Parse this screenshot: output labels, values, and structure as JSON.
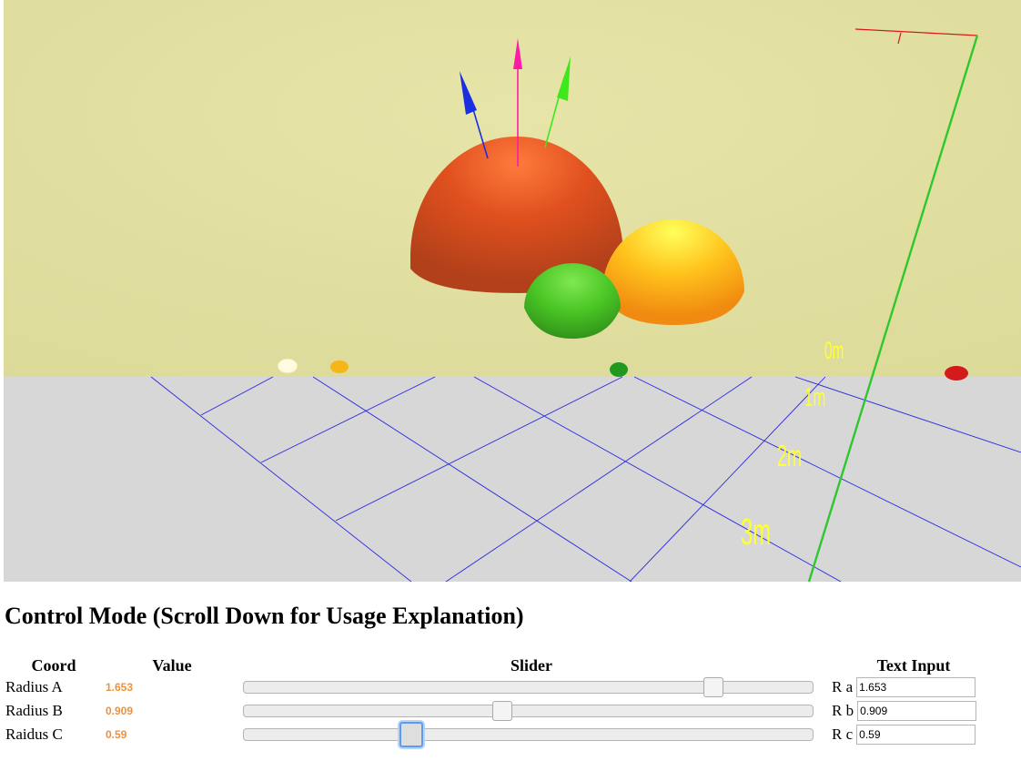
{
  "scene": {
    "colors": {
      "sky": "#e1df9e",
      "floor": "#d7d7d7",
      "grid": "#2a2ae0",
      "axis_x": "#d81818",
      "axis_z": "#2ec82e",
      "arrow_blue": "#1a2fe0",
      "arrow_magenta": "#ff1aa8",
      "arrow_green": "#3ee81a",
      "sphere_a": "#e0501e",
      "sphere_b": "#ffc21c",
      "sphere_c": "#49c524",
      "distance_label": "#ffff33"
    },
    "distance_labels": [
      "0m",
      "1m",
      "2m",
      "3m"
    ]
  },
  "heading": "Control Mode (Scroll Down for Usage Explanation)",
  "controls": {
    "headers": {
      "coord": "Coord",
      "value": "Value",
      "slider": "Slider",
      "text_input": "Text Input"
    },
    "rows": [
      {
        "coord": "Radius A",
        "value": "1.653",
        "slider_fraction": 0.826,
        "input_label": "R a",
        "input_value": "1.653"
      },
      {
        "coord": "Radius B",
        "value": "0.909",
        "slider_fraction": 0.454,
        "input_label": "R b",
        "input_value": "0.909"
      },
      {
        "coord": "Raidus C",
        "value": "0.59",
        "slider_fraction": 0.295,
        "input_label": "R c",
        "input_value": "0.59"
      }
    ]
  }
}
